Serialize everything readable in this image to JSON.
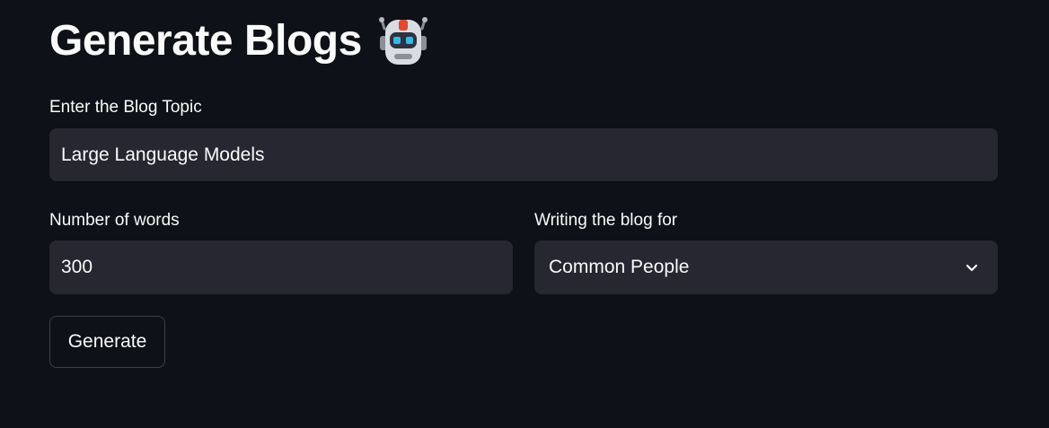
{
  "header": {
    "title": "Generate Blogs",
    "emoji_icon": "robot-icon"
  },
  "form": {
    "topic": {
      "label": "Enter the Blog Topic",
      "value": "Large Language Models"
    },
    "words": {
      "label": "Number of words",
      "value": "300"
    },
    "audience": {
      "label": "Writing the blog for",
      "selected": "Common People",
      "icon": "chevron-down-icon"
    },
    "submit": {
      "label": "Generate"
    }
  },
  "colors": {
    "background": "#0e1117",
    "input_background": "#262730",
    "text": "#fafafa"
  }
}
